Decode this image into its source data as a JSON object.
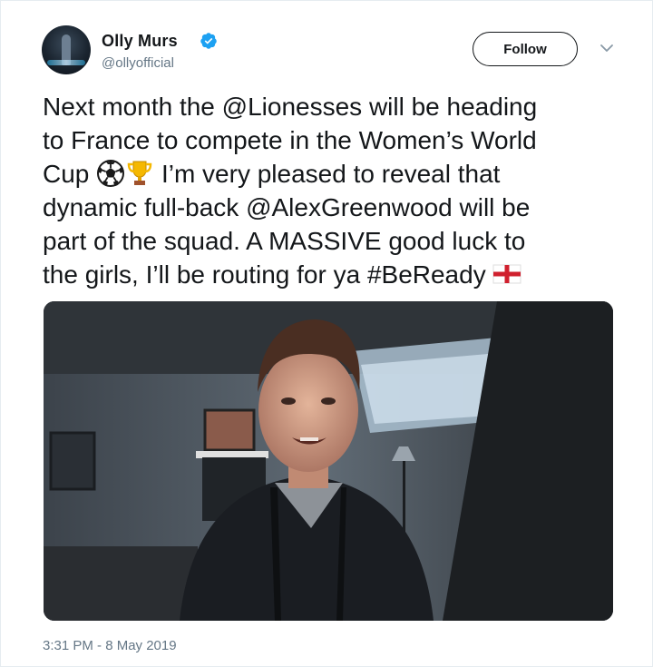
{
  "user": {
    "display_name": "Olly Murs",
    "handle": "@ollyofficial",
    "verified": true,
    "avatar_icon": "profile-photo"
  },
  "follow_label": "Follow",
  "tweet": {
    "lines": [
      "Next month the @Lionesses will be heading",
      "to France to compete in the Women’s World",
      "Cup",
      "I’m very pleased to reveal that",
      "dynamic full-back @AlexGreenwood will be",
      "part of the squad. A MASSIVE good luck to",
      "the girls, I’ll be routing for ya #BeReady"
    ],
    "emojis": [
      "soccer-ball-icon",
      "trophy-icon",
      "england-flag-icon"
    ]
  },
  "media": {
    "type": "video",
    "description_icon": "video-thumbnail"
  },
  "timestamp": "3:31 PM - 8 May 2019",
  "colors": {
    "text": "#14171a",
    "muted": "#657786",
    "verified": "#1da1f2",
    "border": "#e6ecf0"
  }
}
